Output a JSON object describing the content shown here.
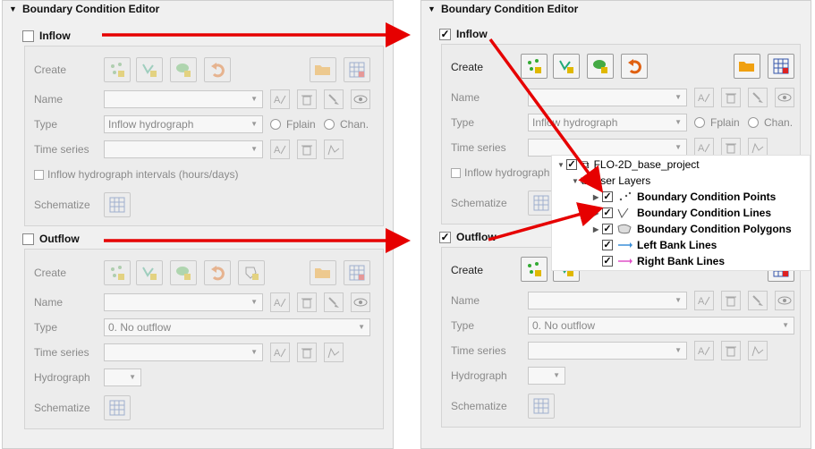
{
  "panel_title": "Boundary Condition Editor",
  "inflow": {
    "title": "Inflow",
    "create_label": "Create",
    "name_label": "Name",
    "name_value": "",
    "type_label": "Type",
    "type_value": "Inflow hydrograph",
    "fplain_label": "Fplain",
    "chan_label": "Chan.",
    "time_series_label": "Time series",
    "time_series_value": "",
    "intervals_label": "Inflow hydrograph intervals (hours/days)",
    "intervals_label_short": "Inflow hydrograph ir",
    "schematize_label": "Schematize"
  },
  "outflow": {
    "title": "Outflow",
    "create_label": "Create",
    "name_label": "Name",
    "name_value": "",
    "type_label": "Type",
    "type_value": "0. No outflow",
    "time_series_label": "Time series",
    "time_series_value": "",
    "hydrograph_label": "Hydrograph",
    "hydrograph_value": "",
    "schematize_label": "Schematize"
  },
  "left_state": {
    "inflow_checked": false,
    "outflow_checked": false
  },
  "right_state": {
    "inflow_checked": true,
    "outflow_checked": true
  },
  "layer_tree": {
    "project": "FLO-2D_base_project",
    "group": "User Layers",
    "layers": [
      {
        "name": "Boundary Condition Points",
        "icon": "points-icon",
        "bold": true
      },
      {
        "name": "Boundary Condition Lines",
        "icon": "lines-icon",
        "bold": true
      },
      {
        "name": "Boundary Condition Polygons",
        "icon": "polygon-icon",
        "bold": true
      },
      {
        "name": "Left Bank Lines",
        "icon": "blue-line-icon",
        "bold": true
      },
      {
        "name": "Right Bank Lines",
        "icon": "pink-line-icon",
        "bold": true
      }
    ]
  },
  "colors": {
    "arrow": "#e60000",
    "panel_bg": "#f0f0f0"
  }
}
